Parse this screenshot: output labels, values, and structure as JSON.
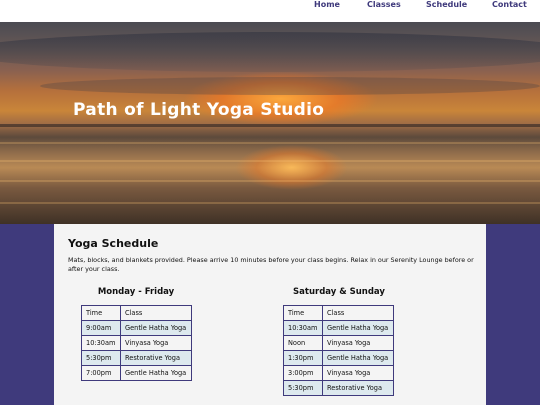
{
  "nav": {
    "items": [
      {
        "label": "Home"
      },
      {
        "label": "Classes"
      },
      {
        "label": "Schedule"
      },
      {
        "label": "Contact"
      }
    ]
  },
  "hero": {
    "title": "Path of Light Yoga Studio"
  },
  "main": {
    "title": "Yoga Schedule",
    "intro": "Mats, blocks, and blankets provided. Please arrive 10 minutes before your class begins. Relax in our Serenity Lounge before or after your class."
  },
  "weekday": {
    "heading": "Monday - Friday",
    "col_time": "Time",
    "col_class": "Class",
    "rows": [
      {
        "time": "9:00am",
        "class": "Gentle Hatha Yoga"
      },
      {
        "time": "10:30am",
        "class": "Vinyasa Yoga"
      },
      {
        "time": "5:30pm",
        "class": "Restorative Yoga"
      },
      {
        "time": "7:00pm",
        "class": "Gentle Hatha Yoga"
      }
    ]
  },
  "weekend": {
    "heading": "Saturday & Sunday",
    "col_time": "Time",
    "col_class": "Class",
    "rows": [
      {
        "time": "10:30am",
        "class": "Gentle Hatha Yoga"
      },
      {
        "time": "Noon",
        "class": "Vinyasa Yoga"
      },
      {
        "time": "1:30pm",
        "class": "Gentle Hatha Yoga"
      },
      {
        "time": "3:00pm",
        "class": "Vinyasa Yoga"
      },
      {
        "time": "5:30pm",
        "class": "Restorative Yoga"
      }
    ]
  },
  "colors": {
    "brand": "#3f3a7c",
    "row_alt": "#dde9ee",
    "panel": "#f4f4f4"
  }
}
